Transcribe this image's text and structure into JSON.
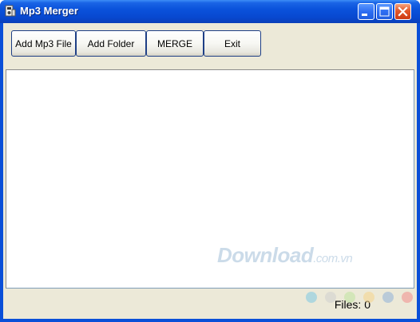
{
  "window": {
    "title": "Mp3 Merger",
    "title_icon": "app-icon",
    "controls": [
      "minimize-icon",
      "maximize-icon",
      "close-icon"
    ]
  },
  "toolbar": {
    "add_mp3_file": "Add Mp3 File",
    "add_folder": "Add Folder",
    "merge": "MERGE",
    "exit": "Exit"
  },
  "file_list": [],
  "status": {
    "files_count": "Files: 0"
  },
  "watermark": {
    "brand": "Download",
    "domain": ".com.vn",
    "dot_colors": [
      "#7ec8e3",
      "#d0d0d0",
      "#bfe3a0",
      "#f5d38a",
      "#8fb0d8",
      "#f28c8c"
    ]
  },
  "colors": {
    "titlebar": "#0a52db",
    "client_bg": "#ece9d8",
    "close_button": "#e2572a"
  }
}
